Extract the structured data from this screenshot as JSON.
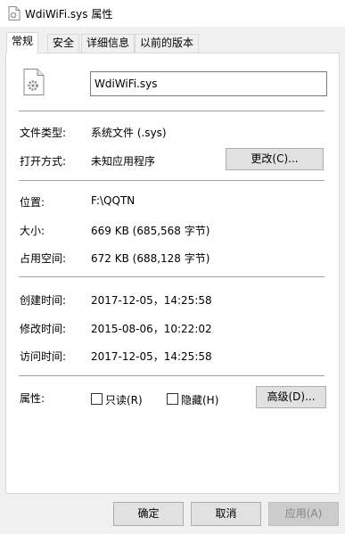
{
  "window": {
    "title": "WdiWiFi.sys 属性",
    "tabs": [
      "常规",
      "安全",
      "详细信息",
      "以前的版本"
    ]
  },
  "general": {
    "filename": "WdiWiFi.sys",
    "type_label": "文件类型:",
    "type_value": "系统文件 (.sys)",
    "open_label": "打开方式:",
    "open_value": "未知应用程序",
    "change_button": "更改(C)...",
    "location_label": "位置:",
    "location_value": "F:\\QQTN",
    "size_label": "大小:",
    "size_value": "669 KB (685,568 字节)",
    "disk_label": "占用空间:",
    "disk_value": "672 KB (688,128 字节)",
    "created_label": "创建时间:",
    "created_value": "2017-12-05，14:25:58",
    "modified_label": "修改时间:",
    "modified_value": "2015-08-06，10:22:02",
    "accessed_label": "访问时间:",
    "accessed_value": "2017-12-05，14:25:58",
    "attributes_label": "属性:",
    "readonly_label": "只读(R)",
    "readonly_checked": false,
    "hidden_label": "隐藏(H)",
    "hidden_checked": false,
    "advanced_button": "高级(D)..."
  },
  "footer": {
    "ok": "确定",
    "cancel": "取消",
    "apply": "应用(A)"
  },
  "colors": {
    "panel": "#ffffff",
    "background": "#f0f0f0",
    "button": "#e1e1e1",
    "separator": "#a0a0a0",
    "disabled_text": "#838383"
  },
  "icons": [
    "file-icon",
    "gear-icon"
  ]
}
